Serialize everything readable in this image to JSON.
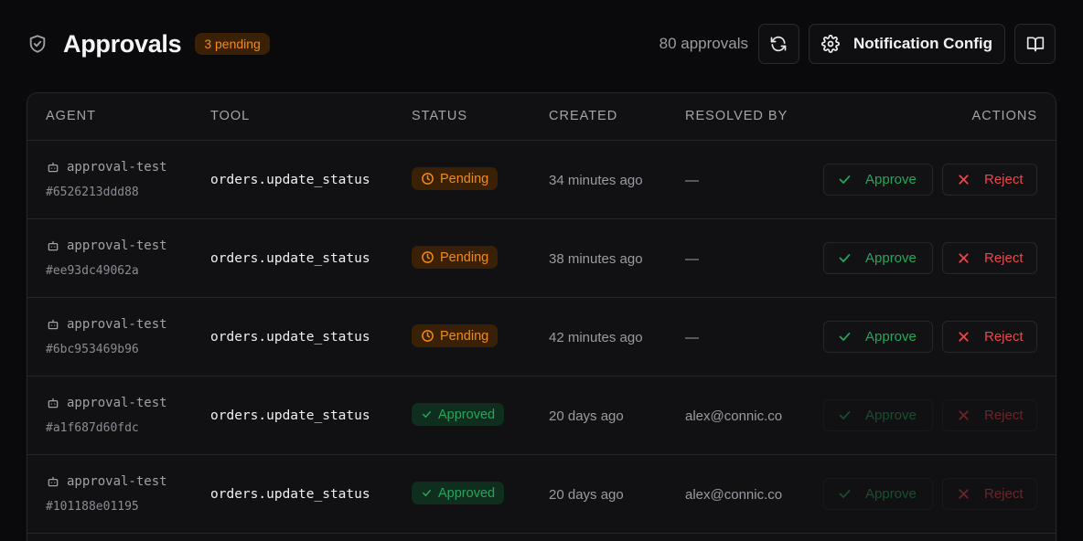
{
  "header": {
    "title": "Approvals",
    "pending_badge": "3 pending",
    "count": "80 approvals",
    "notification_config_label": "Notification Config"
  },
  "table": {
    "columns": {
      "agent": "AGENT",
      "tool": "TOOL",
      "status": "STATUS",
      "created": "CREATED",
      "resolved_by": "RESOLVED BY",
      "actions": "ACTIONS"
    },
    "approve_label": "Approve",
    "reject_label": "Reject",
    "rows": [
      {
        "agent": "approval-test",
        "id": "#6526213ddd88",
        "tool": "orders.update_status",
        "status": "Pending",
        "created": "34 minutes ago",
        "resolved_by": "—"
      },
      {
        "agent": "approval-test",
        "id": "#ee93dc49062a",
        "tool": "orders.update_status",
        "status": "Pending",
        "created": "38 minutes ago",
        "resolved_by": "—"
      },
      {
        "agent": "approval-test",
        "id": "#6bc953469b96",
        "tool": "orders.update_status",
        "status": "Pending",
        "created": "42 minutes ago",
        "resolved_by": "—"
      },
      {
        "agent": "approval-test",
        "id": "#a1f687d60fdc",
        "tool": "orders.update_status",
        "status": "Approved",
        "created": "20 days ago",
        "resolved_by": "alex@connic.co"
      },
      {
        "agent": "approval-test",
        "id": "#101188e01195",
        "tool": "orders.update_status",
        "status": "Approved",
        "created": "20 days ago",
        "resolved_by": "alex@connic.co"
      }
    ]
  },
  "colors": {
    "background": "#0a0a0c",
    "pending": "#f08a1c",
    "approved": "#26a65b",
    "reject": "#e5484d"
  }
}
